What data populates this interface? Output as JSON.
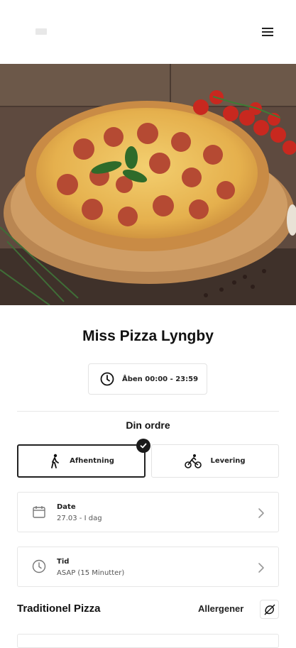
{
  "header": {
    "logo_icon": "logo-icon",
    "menu_icon": "hamburger-menu-icon"
  },
  "hero": {
    "image_desc_icon": "pizza-photo"
  },
  "restaurant": {
    "name": "Miss Pizza Lyngby"
  },
  "hours": {
    "text": "Åben 00:00 - 23:59"
  },
  "order": {
    "title": "Din ordre",
    "options": [
      {
        "label": "Afhentning",
        "icon": "walking-person-icon",
        "selected": true
      },
      {
        "label": "Levering",
        "icon": "cyclist-icon",
        "selected": false
      }
    ]
  },
  "date": {
    "label": "Date",
    "value": "27.03 - I dag"
  },
  "time": {
    "label": "Tid",
    "value": "ASAP (15 Minutter)"
  },
  "menu_section": {
    "title": "Traditionel Pizza",
    "allergens_label": "Allergener"
  }
}
